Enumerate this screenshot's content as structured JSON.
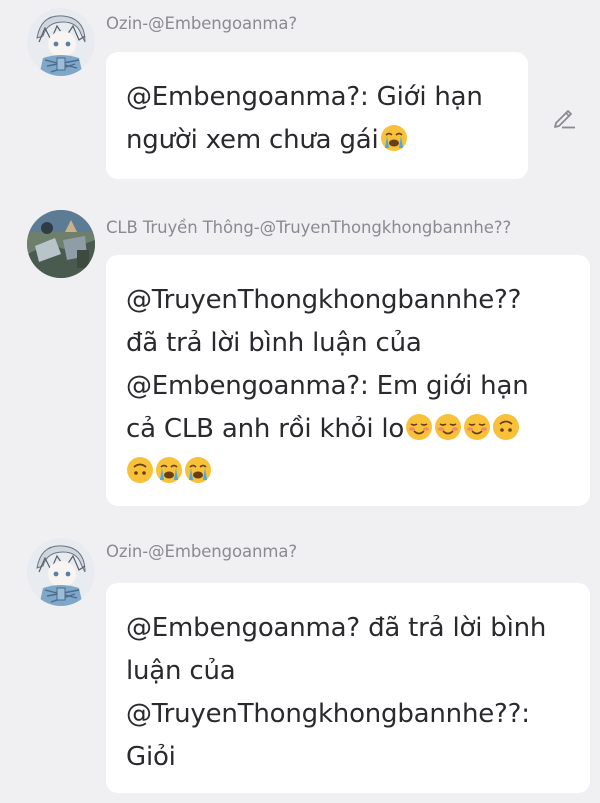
{
  "comments": [
    {
      "username": "Ozin-@Embengoanma?",
      "lines": [
        "@Embengoanma?: Giới hạn",
        "người xem chưa gái"
      ],
      "emoji_line": 1,
      "emojis": [
        "loudly-crying-face"
      ],
      "editable": true
    },
    {
      "username": "CLB Truyền Thông-@TruyenThongkhongbannhe??",
      "lines": [
        "@TruyenThongkhongbannhe??",
        "đã trả lời bình luận của",
        "@Embengoanma?: Em giới hạn",
        "cả CLB anh rồi khỏi lo"
      ],
      "emoji_line": 3,
      "emojis": [
        "smiling-face",
        "smiling-face",
        "smiling-face",
        "upside-down-face",
        "upside-down-face",
        "loudly-crying-face",
        "loudly-crying-face"
      ],
      "editable": false
    },
    {
      "username": "Ozin-@Embengoanma?",
      "lines": [
        "@Embengoanma? đã trả lời bình",
        "luận của",
        "@TruyenThongkhongbannhe??:",
        "Giỏi"
      ],
      "emoji_line": -1,
      "emojis": [],
      "editable": false
    }
  ],
  "colors": {
    "background": "#f0f0f3",
    "bubble": "#ffffff",
    "username": "#8a8a92",
    "text": "#2a2a2e"
  }
}
